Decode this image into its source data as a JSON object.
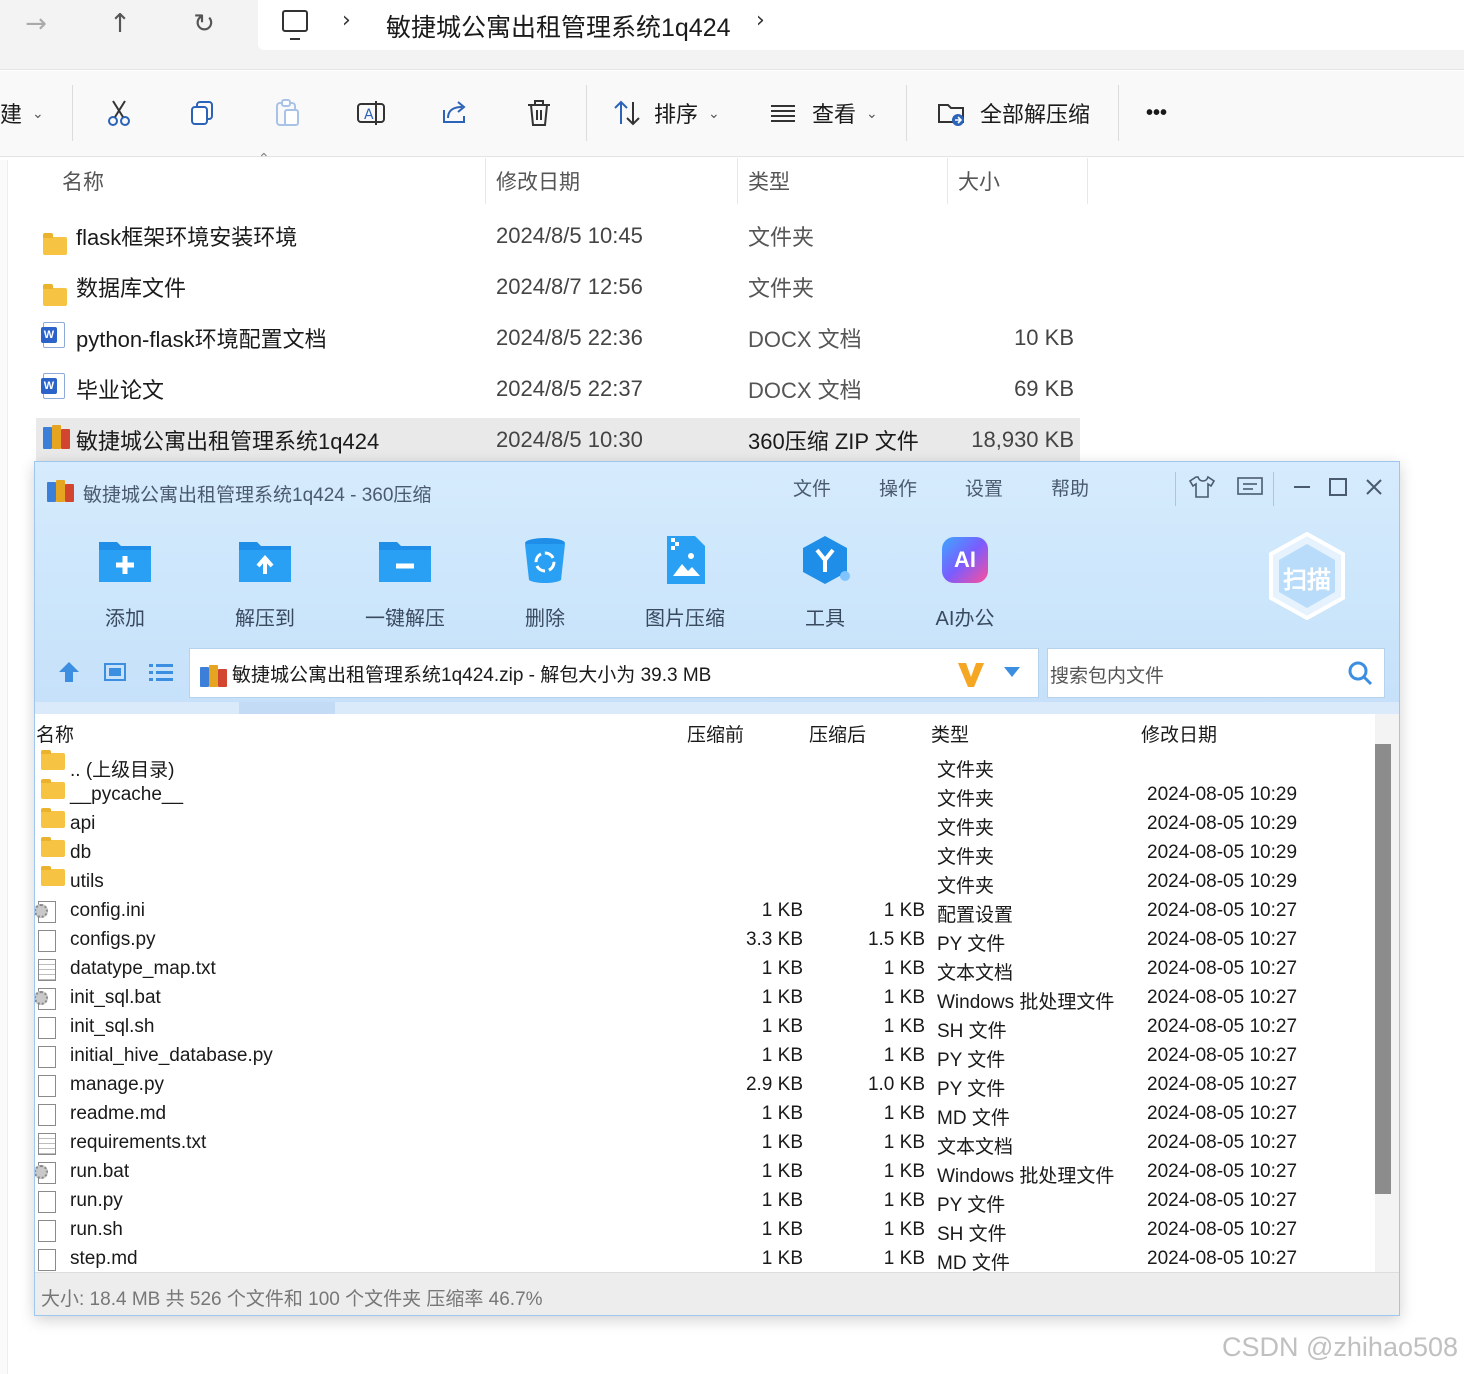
{
  "explorer": {
    "breadcrumb": "敏捷城公寓出租管理系统1q424",
    "toolbar": {
      "new_label": "建",
      "sort_label": "排序",
      "view_label": "查看",
      "extract_all_label": "全部解压缩",
      "more_label": "•••"
    },
    "columns": {
      "name": "名称",
      "date": "修改日期",
      "type": "类型",
      "size": "大小"
    },
    "files": [
      {
        "name": "flask框架环境安装环境",
        "date": "2024/8/5 10:45",
        "type": "文件夹",
        "size": "",
        "icon": "folder-icon"
      },
      {
        "name": "数据库文件",
        "date": "2024/8/7 12:56",
        "type": "文件夹",
        "size": "",
        "icon": "folder-icon"
      },
      {
        "name": "python-flask环境配置文档",
        "date": "2024/8/5 22:36",
        "type": "DOCX 文档",
        "size": "10 KB",
        "icon": "word-doc-icon"
      },
      {
        "name": "毕业论文",
        "date": "2024/8/5 22:37",
        "type": "DOCX 文档",
        "size": "69 KB",
        "icon": "word-doc-icon"
      },
      {
        "name": "敏捷城公寓出租管理系统1q424",
        "date": "2024/8/5 10:30",
        "type": "360压缩 ZIP 文件",
        "size": "18,930 KB",
        "icon": "zip-archive-icon"
      }
    ]
  },
  "zip_window": {
    "title": "敏捷城公寓出租管理系统1q424 - 360压缩",
    "menu": {
      "file": "文件",
      "operate": "操作",
      "settings": "设置",
      "help": "帮助"
    },
    "tools": {
      "add": "添加",
      "extract_to": "解压到",
      "one_click": "一键解压",
      "delete": "删除",
      "image_compress": "图片压缩",
      "tools": "工具",
      "ai_office": "AI办公"
    },
    "ai_badge": "AI",
    "scan_label": "扫描",
    "path_text": "敏捷城公寓出租管理系统1q424.zip - 解包大小为 39.3 MB",
    "search_placeholder": "搜索包内文件",
    "columns": {
      "name": "名称",
      "before": "压缩前",
      "after": "压缩后",
      "type": "类型",
      "date": "修改日期"
    },
    "rows": [
      {
        "name": ".. (上级目录)",
        "before": "",
        "after": "",
        "type": "文件夹",
        "date": "",
        "icon": "folder"
      },
      {
        "name": "__pycache__",
        "before": "",
        "after": "",
        "type": "文件夹",
        "date": "2024-08-05 10:29",
        "icon": "folder"
      },
      {
        "name": "api",
        "before": "",
        "after": "",
        "type": "文件夹",
        "date": "2024-08-05 10:29",
        "icon": "folder"
      },
      {
        "name": "db",
        "before": "",
        "after": "",
        "type": "文件夹",
        "date": "2024-08-05 10:29",
        "icon": "folder"
      },
      {
        "name": "utils",
        "before": "",
        "after": "",
        "type": "文件夹",
        "date": "2024-08-05 10:29",
        "icon": "folder"
      },
      {
        "name": "config.ini",
        "before": "1 KB",
        "after": "1 KB",
        "type": "配置设置",
        "date": "2024-08-05 10:27",
        "icon": "gear"
      },
      {
        "name": "configs.py",
        "before": "3.3 KB",
        "after": "1.5 KB",
        "type": "PY 文件",
        "date": "2024-08-05 10:27",
        "icon": "file"
      },
      {
        "name": "datatype_map.txt",
        "before": "1 KB",
        "after": "1 KB",
        "type": "文本文档",
        "date": "2024-08-05 10:27",
        "icon": "text"
      },
      {
        "name": "init_sql.bat",
        "before": "1 KB",
        "after": "1 KB",
        "type": "Windows 批处理文件",
        "date": "2024-08-05 10:27",
        "icon": "gear"
      },
      {
        "name": "init_sql.sh",
        "before": "1 KB",
        "after": "1 KB",
        "type": "SH 文件",
        "date": "2024-08-05 10:27",
        "icon": "file"
      },
      {
        "name": "initial_hive_database.py",
        "before": "1 KB",
        "after": "1 KB",
        "type": "PY 文件",
        "date": "2024-08-05 10:27",
        "icon": "file"
      },
      {
        "name": "manage.py",
        "before": "2.9 KB",
        "after": "1.0 KB",
        "type": "PY 文件",
        "date": "2024-08-05 10:27",
        "icon": "file"
      },
      {
        "name": "readme.md",
        "before": "1 KB",
        "after": "1 KB",
        "type": "MD 文件",
        "date": "2024-08-05 10:27",
        "icon": "file"
      },
      {
        "name": "requirements.txt",
        "before": "1 KB",
        "after": "1 KB",
        "type": "文本文档",
        "date": "2024-08-05 10:27",
        "icon": "text"
      },
      {
        "name": "run.bat",
        "before": "1 KB",
        "after": "1 KB",
        "type": "Windows 批处理文件",
        "date": "2024-08-05 10:27",
        "icon": "gear"
      },
      {
        "name": "run.py",
        "before": "1 KB",
        "after": "1 KB",
        "type": "PY 文件",
        "date": "2024-08-05 10:27",
        "icon": "file"
      },
      {
        "name": "run.sh",
        "before": "1 KB",
        "after": "1 KB",
        "type": "SH 文件",
        "date": "2024-08-05 10:27",
        "icon": "file"
      },
      {
        "name": "step.md",
        "before": "1 KB",
        "after": "1 KB",
        "type": "MD 文件",
        "date": "2024-08-05 10:27",
        "icon": "file"
      }
    ],
    "status": "大小: 18.4 MB 共 526 个文件和 100 个文件夹 压缩率 46.7%"
  },
  "watermark": "CSDN @zhihao508"
}
